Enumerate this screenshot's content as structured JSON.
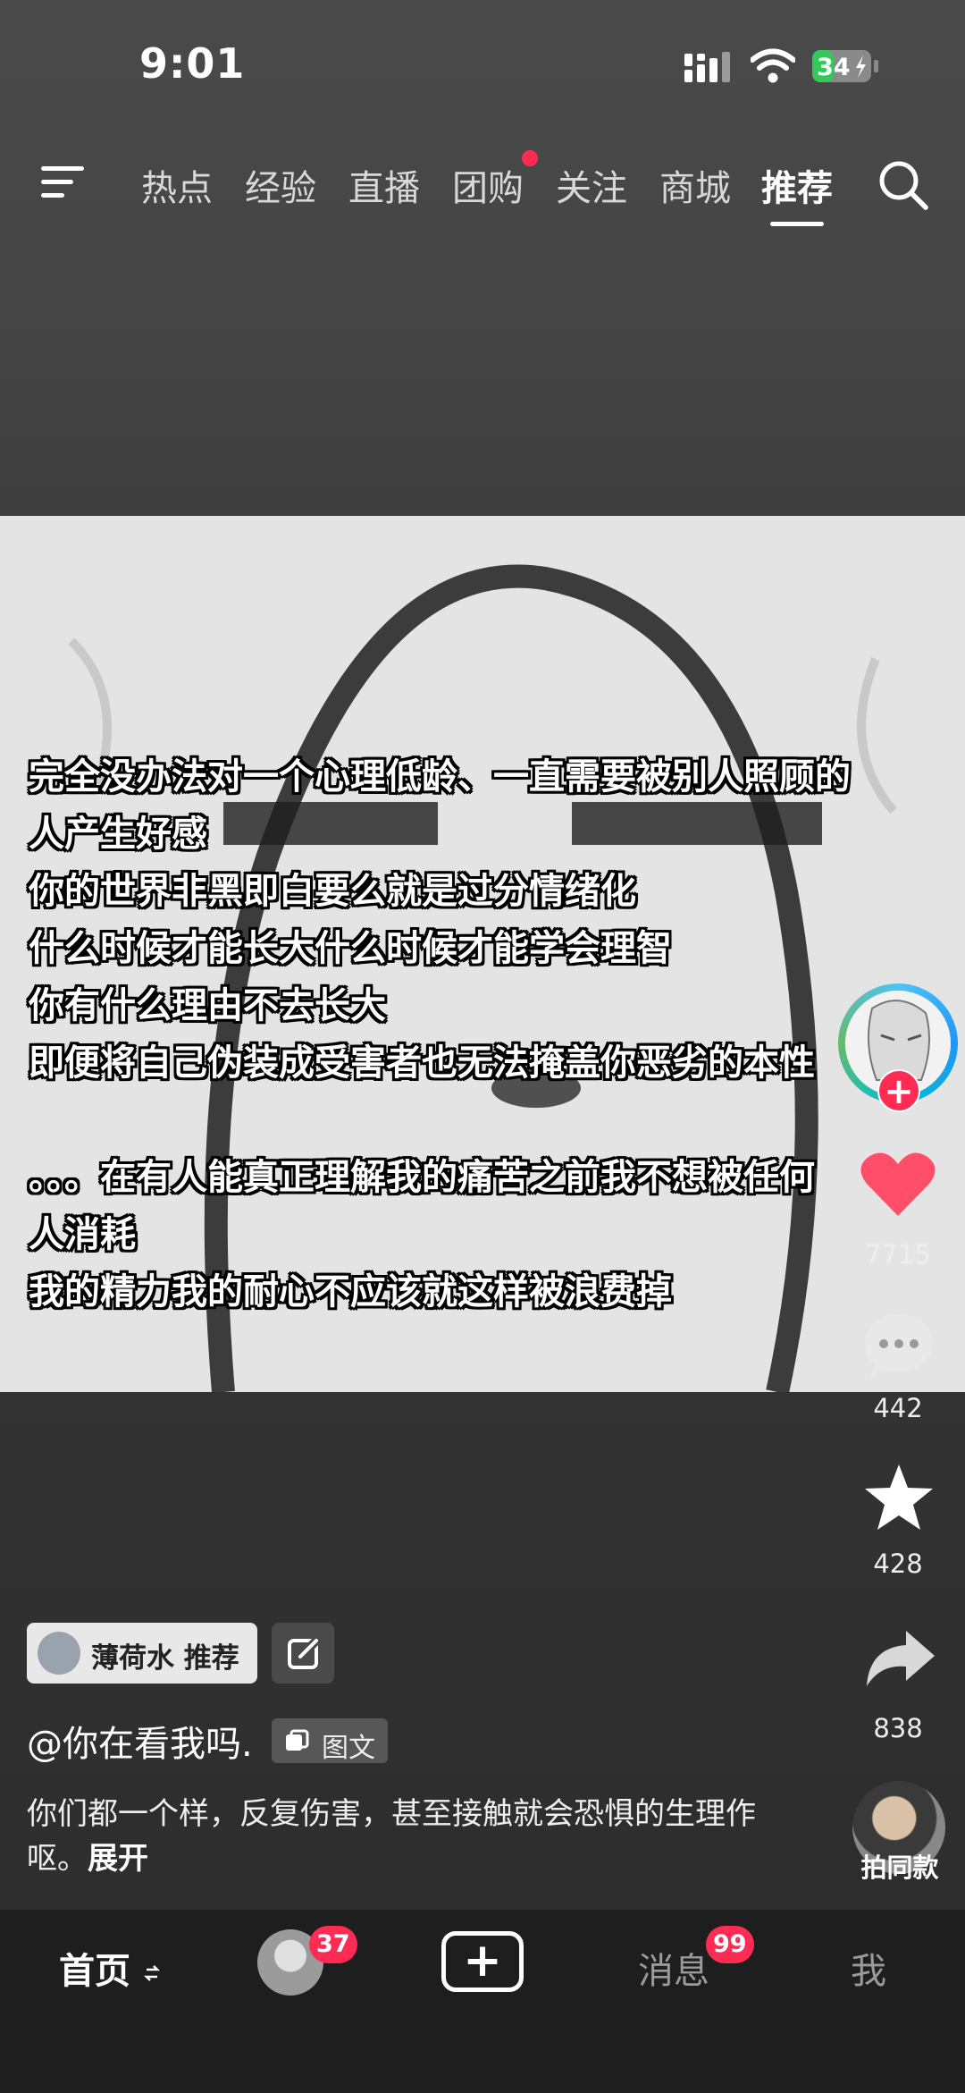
{
  "status_bar": {
    "time": "9:01",
    "battery": "34"
  },
  "top_nav": {
    "tabs": [
      {
        "label": "热点"
      },
      {
        "label": "经验"
      },
      {
        "label": "直播"
      },
      {
        "label": "团购"
      },
      {
        "label": "关注"
      },
      {
        "label": "商城"
      },
      {
        "label": "推荐"
      }
    ],
    "active_tab": "推荐"
  },
  "post": {
    "overlay_lines": [
      "完全没办法对一个心理低龄、一直需要被别人照顾的",
      "人产生好感",
      "你的世界非黑即白要么就是过分情绪化",
      "什么时候才能长大什么时候才能学会理智",
      "你有什么理由不去长大",
      "即便将自己伪装成受害者也无法掩盖你恶劣的本性",
      "。。。在有人能真正理解我的痛苦之前我不想被任何",
      "人消耗",
      "我的精力我的耐心不应该就这样被浪费掉"
    ],
    "recommend_chip": "薄荷水 推荐",
    "author": "@你在看我吗.",
    "type_label": "图文",
    "description": "你们都一个样，反复伤害，甚至接触就会恐惧的生理作呕。",
    "expand_label": "展开"
  },
  "actions": {
    "likes": "7715",
    "comments": "442",
    "favorites": "428",
    "shares": "838",
    "remix_label": "拍同款"
  },
  "bottom_nav": {
    "home": "首页",
    "friends_badge": "37",
    "messages": "消息",
    "messages_badge": "99",
    "me": "我"
  },
  "colors": {
    "accent": "#fe2c55",
    "like": "#ff4d6a"
  }
}
